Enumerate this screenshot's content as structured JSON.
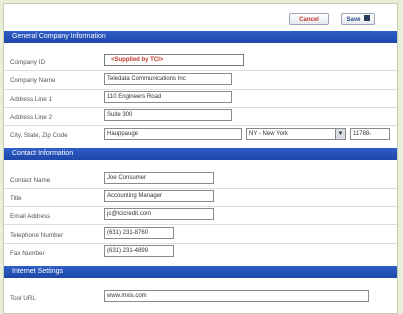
{
  "toolbar": {
    "cancel_label": "Cancel",
    "save_label": "Save"
  },
  "sections": {
    "general": "General Company Information",
    "contact": "Contact Information",
    "internet": "Internet Settings"
  },
  "general": {
    "company_id_label": "Company ID",
    "company_id_value": "<Supplied by TCI>",
    "company_name_label": "Company Name",
    "company_name_value": "Teledata Communications Inc",
    "address1_label": "Address Line 1",
    "address1_value": "110 Engineers Road",
    "address2_label": "Address Line 2",
    "address2_value": "Suite 300",
    "city_label": "City, State, Zip Code",
    "city_value": "Hauppauge",
    "state_value": "NY - New York",
    "zip_value": "11788-"
  },
  "contact": {
    "name_label": "Contact Name",
    "name_value": "Joe Consumer",
    "title_label": "Title",
    "title_value": "Accounting Manager",
    "email_label": "Email Address",
    "email_value": "jc@tcicredit.com",
    "phone_label": "Telephone Number",
    "phone_value": "(631) 231-8760",
    "fax_label": "Fax Number",
    "fax_value": "(631) 231-4899"
  },
  "internet": {
    "url_label": "Tool URL",
    "url_value": "www.mxis.com"
  }
}
